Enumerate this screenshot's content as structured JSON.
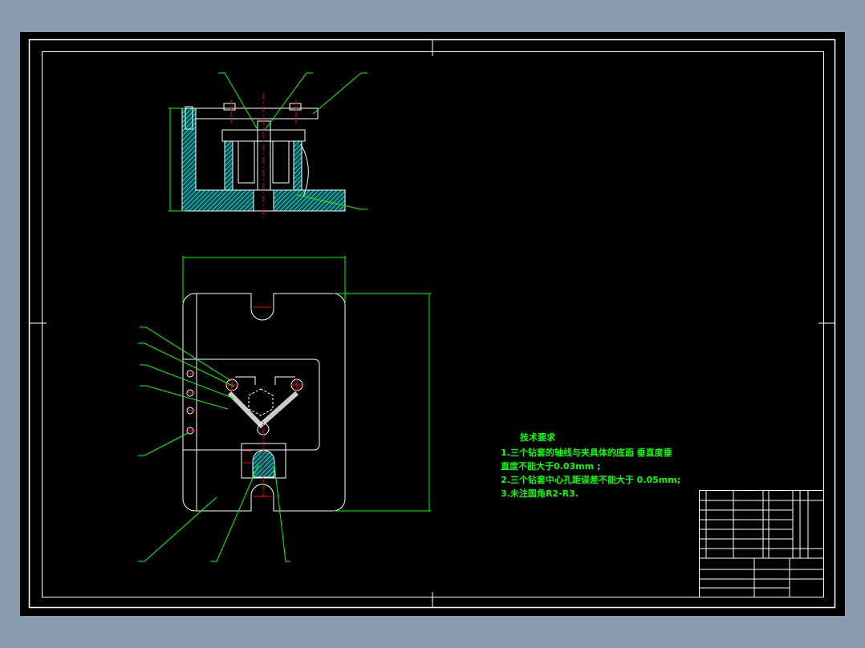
{
  "drawing": {
    "background": "#000000",
    "line_color": "#ffffff",
    "dimension_color": "#00ff00",
    "centerline_color": "#ff0000",
    "hatch_color": "#00e5e5"
  },
  "technical_requirements": {
    "title": "技术要求",
    "items": [
      "1.三个钻套的轴线与夹具体的底面 垂直度垂",
      "直度不能大于0.03mm ;",
      "2.三个钻套中心孔距误差不能大于   0.05mm;",
      "3.未注圆角R2-R3."
    ]
  }
}
